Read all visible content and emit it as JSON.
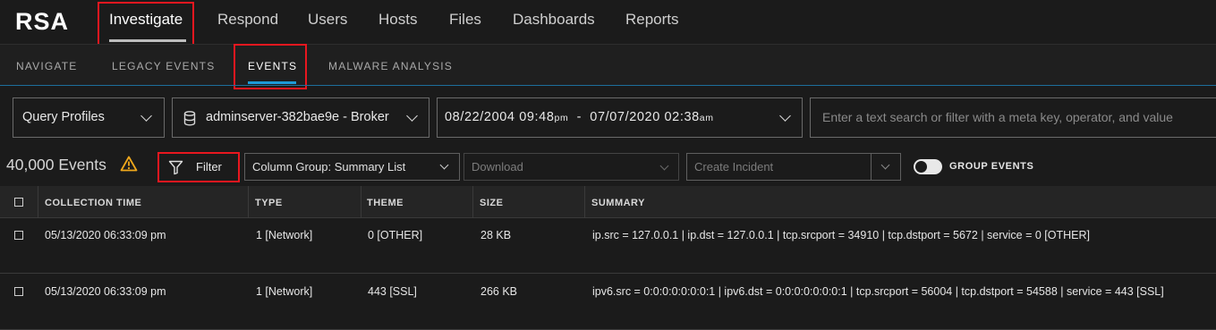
{
  "topnav": {
    "logo": "RSA",
    "items": [
      {
        "label": "Investigate",
        "active": true
      },
      {
        "label": "Respond"
      },
      {
        "label": "Users"
      },
      {
        "label": "Hosts"
      },
      {
        "label": "Files"
      },
      {
        "label": "Dashboards"
      },
      {
        "label": "Reports"
      }
    ]
  },
  "subnav": {
    "items": [
      {
        "label": "NAVIGATE"
      },
      {
        "label": "LEGACY EVENTS"
      },
      {
        "label": "EVENTS",
        "active": true
      },
      {
        "label": "MALWARE ANALYSIS"
      }
    ]
  },
  "querybar": {
    "profiles": "Query Profiles",
    "service": "adminserver-382bae9e - Broker",
    "range_start_date": "08/22/2004",
    "range_start_time": "09:48",
    "range_start_ampm": "pm",
    "range_sep": "-",
    "range_end_date": "07/07/2020",
    "range_end_time": "02:38",
    "range_end_ampm": "am",
    "search_placeholder": "Enter a text search or filter with a meta key, operator, and value"
  },
  "toolbar": {
    "count": "40,000 Events",
    "filter_label": "Filter",
    "column_group": "Column Group: Summary List",
    "download": "Download",
    "create_incident": "Create Incident",
    "group_events": "GROUP EVENTS"
  },
  "table": {
    "headers": [
      "COLLECTION TIME",
      "TYPE",
      "THEME",
      "SIZE",
      "SUMMARY"
    ],
    "rows": [
      {
        "time": "05/13/2020 06:33:09 pm",
        "type": "1 [Network]",
        "theme": "0 [OTHER]",
        "size": "28 KB",
        "summary": "ip.src = 127.0.0.1 | ip.dst = 127.0.0.1 | tcp.srcport = 34910 | tcp.dstport = 5672 | service = 0 [OTHER]"
      },
      {
        "time": "05/13/2020 06:33:09 pm",
        "type": "1 [Network]",
        "theme": "443 [SSL]",
        "size": "266 KB",
        "summary": "ipv6.src = 0:0:0:0:0:0:0:1 | ipv6.dst = 0:0:0:0:0:0:0:1 | tcp.srcport = 56004 | tcp.dstport = 54588 | service = 443 [SSL]"
      }
    ]
  },
  "colors": {
    "background": "#1b1b1b",
    "accent_blue": "#1e9ad6",
    "highlight_red": "#e8171f",
    "warning_yellow": "#f0a81c"
  },
  "icons": [
    "database-icon",
    "warning-icon",
    "filter-funnel-icon",
    "chevron-down-icon",
    "checkbox-icon",
    "toggle-icon"
  ]
}
